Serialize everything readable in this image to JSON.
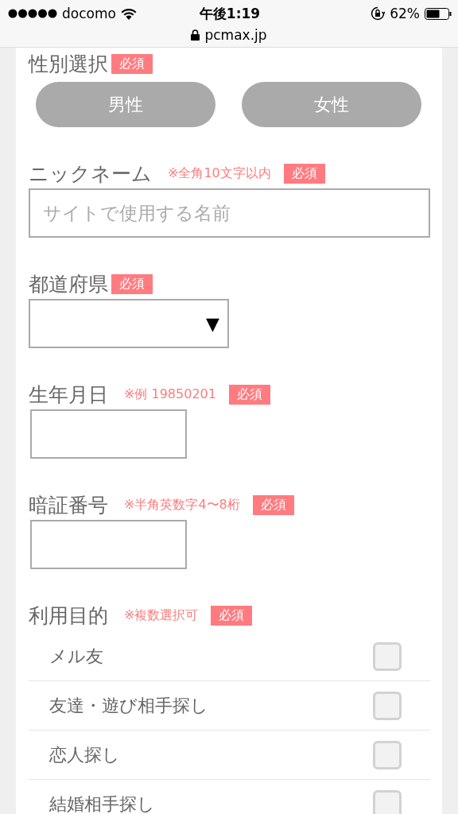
{
  "status_bar": {
    "carrier": "docomo",
    "time": "午後1:19",
    "battery": "62%",
    "url": "pcmax.jp"
  },
  "fields": [
    {
      "kind": "choice",
      "label": "性別選択",
      "badge": "必須",
      "options": [
        {
          "label": "男性",
          "selected": false
        },
        {
          "label": "女性",
          "selected": false
        }
      ]
    },
    {
      "kind": "text",
      "label": "ニックネーム",
      "note": "※全角10文字以内",
      "badge": "必須",
      "placeholder": "サイトで使用する名前"
    },
    {
      "kind": "select",
      "label": "都道府県",
      "badge": "必須",
      "arrow": "▼"
    },
    {
      "kind": "short",
      "label": "生年月日",
      "note": "※例 19850201",
      "badge": "必須"
    },
    {
      "kind": "short",
      "label": "暗証番号",
      "note": "※半角英数字4〜8桁",
      "badge": "必須"
    },
    {
      "kind": "checklist",
      "label": "利用目的",
      "note": "※複数選択可",
      "badge": "必須",
      "items": [
        {
          "label": "メル友",
          "checked": false
        },
        {
          "label": "友達・遊び相手探し",
          "checked": false
        },
        {
          "label": "恋人探し",
          "checked": false
        },
        {
          "label": "結婚相手探し",
          "checked": false
        }
      ]
    }
  ]
}
